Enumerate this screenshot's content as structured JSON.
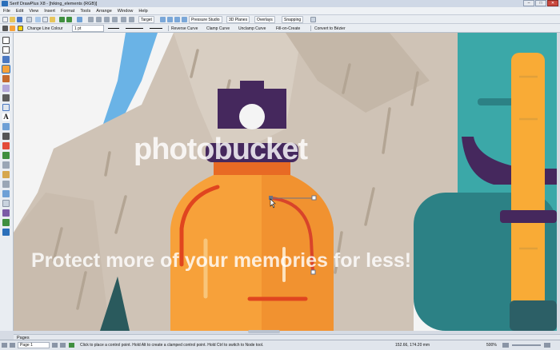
{
  "window": {
    "title": "Serif DrawPlus X8 - [hiking_elements (RGB)]",
    "controls": [
      "–",
      "□",
      "✕"
    ]
  },
  "menu": [
    "File",
    "Edit",
    "View",
    "Insert",
    "Format",
    "Tools",
    "Arrange",
    "Window",
    "Help"
  ],
  "standard_toolbar": {
    "target_label": "Target",
    "pressure_studio_label": "Pressure Studio",
    "planes_3d_label": "3D Planes",
    "overlays_label": "Overlays",
    "snapping_label": "Snapping"
  },
  "context_toolbar": {
    "change_line_colour": "Change Line Colour",
    "line_width": "1 pt",
    "reverse_curve": "Reverse Curve",
    "clamp_curve": "Clamp Curve",
    "unclamp_curve": "Unclamp Curve",
    "fill_on_create": "Fill-on-Create",
    "convert_to_bezier": "Convert to Bézier"
  },
  "pages_tab": {
    "label": "Pages"
  },
  "status": {
    "page": "Page 1",
    "hint": "Click to place a control point. Hold Alt to create a clamped control point. Hold Ctrl to switch to Node tool.",
    "coords": "152.66, 174.20 mm",
    "zoom": "500%"
  },
  "watermark": {
    "brand": "photobucket",
    "tagline": "Protect more of your memories for less!"
  },
  "colors": {
    "accent": "#2b6fba",
    "bottle_orange": "#f7a13a",
    "bottle_dark_orange": "#e86a24",
    "cap_purple": "#45285d",
    "rock_beige": "#cfc3b6",
    "backpack_teal": "#3ba8a8",
    "strap_yellow": "#f9ab36",
    "sky_blue": "#6ab3e6"
  }
}
